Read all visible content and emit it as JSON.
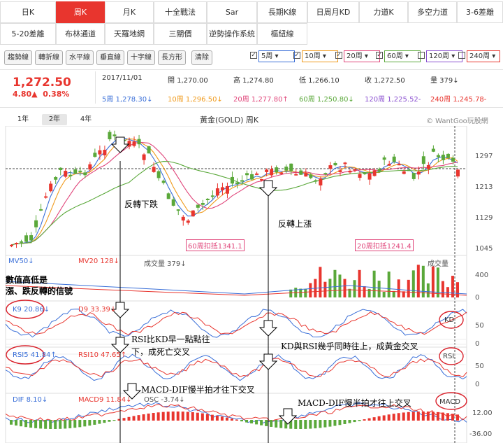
{
  "period_tabs": {
    "row1": [
      "日K",
      "周K",
      "月K",
      "十全戰法",
      "Sar",
      "長期K線",
      "日周月KD",
      "力道K",
      "多空力道",
      "3-6差離"
    ],
    "row2": [
      "5-20差離",
      "布林通道",
      "天羅地網",
      "三關價",
      "逆勢操作系統",
      "樞紐線"
    ],
    "active": "周K"
  },
  "toolbar": {
    "tools": [
      "趨勢線",
      "轉折線",
      "水平線",
      "垂直線",
      "十字線",
      "長方形",
      "清除"
    ],
    "ma_options": [
      "5周",
      "10周",
      "20周",
      "60周",
      "120周",
      "240周"
    ],
    "ma_checked": [
      true,
      true,
      true,
      true,
      false,
      false
    ],
    "ma_colors": [
      "#3a6fd8",
      "#f09a1b",
      "#e0457a",
      "#5aa83a",
      "#8a4fd0",
      "#e8352e"
    ]
  },
  "quote": {
    "price": "1,272.50",
    "change": "4.80▲",
    "change_pct": "0.38%",
    "date": "2017/11/01",
    "open": "開 1,270.00",
    "high": "高 1,274.80",
    "low": "低 1,266.10",
    "close": "收 1,272.50",
    "volume": "量 379↓",
    "ma5": "5周 1,278.30↓",
    "ma10": "10周 1,296.50↓",
    "ma20": "20周 1,277.80↑",
    "ma60": "60周 1,250.80↓",
    "ma120": "120周 1,225.52-",
    "ma240": "240周 1,245.78-"
  },
  "chart": {
    "range_tabs": [
      "1年",
      "2年",
      "4年"
    ],
    "active_range": "2年",
    "title": "黃金(GOLD) 周K",
    "source": "© WantGoo玩股網",
    "y_ticks": [
      "1297",
      "1213",
      "1129",
      "1045"
    ],
    "tag_left": "60周扣抵1341.1",
    "tag_right": "20周扣抵1241.4",
    "vol": {
      "mv5": "MV50↓",
      "mv20": "MV20 128↓",
      "vol": "成交量 379↓",
      "label_right": "成交量",
      "ticks": [
        "400",
        "0"
      ]
    },
    "kd": {
      "k": "K9 20.86↓",
      "d": "D9 33.39↓",
      "badge": "KD",
      "ticks": [
        "50",
        "0"
      ]
    },
    "rsi": {
      "r5": "RSI5 41.84↑",
      "r10": "RSI10 47.65↑",
      "badge": "RSI",
      "ticks": [
        "50",
        "0"
      ]
    },
    "macd": {
      "dif": "DIF 8.10↓",
      "macd": "MACD9 11.84↓",
      "osc": "OSC -3.74↓",
      "badge": "MACD",
      "ticks": [
        "12.00",
        "-36.00"
      ]
    }
  },
  "annotations": {
    "a1": "反轉下跌",
    "a2": "反轉上漲",
    "a3_line1": "數值高低是",
    "a3_line2": "漲、跌反轉的信號",
    "a4_line1": "RSI比KD早一點點往",
    "a4_line2": "下，成死亡交叉",
    "a5": "KD與RSI幾乎同時往上，成黃金交叉",
    "a6": "MACD-DIF慢半拍才往下交叉",
    "a7": "MACD-DIF慢半拍才往上交叉"
  }
}
